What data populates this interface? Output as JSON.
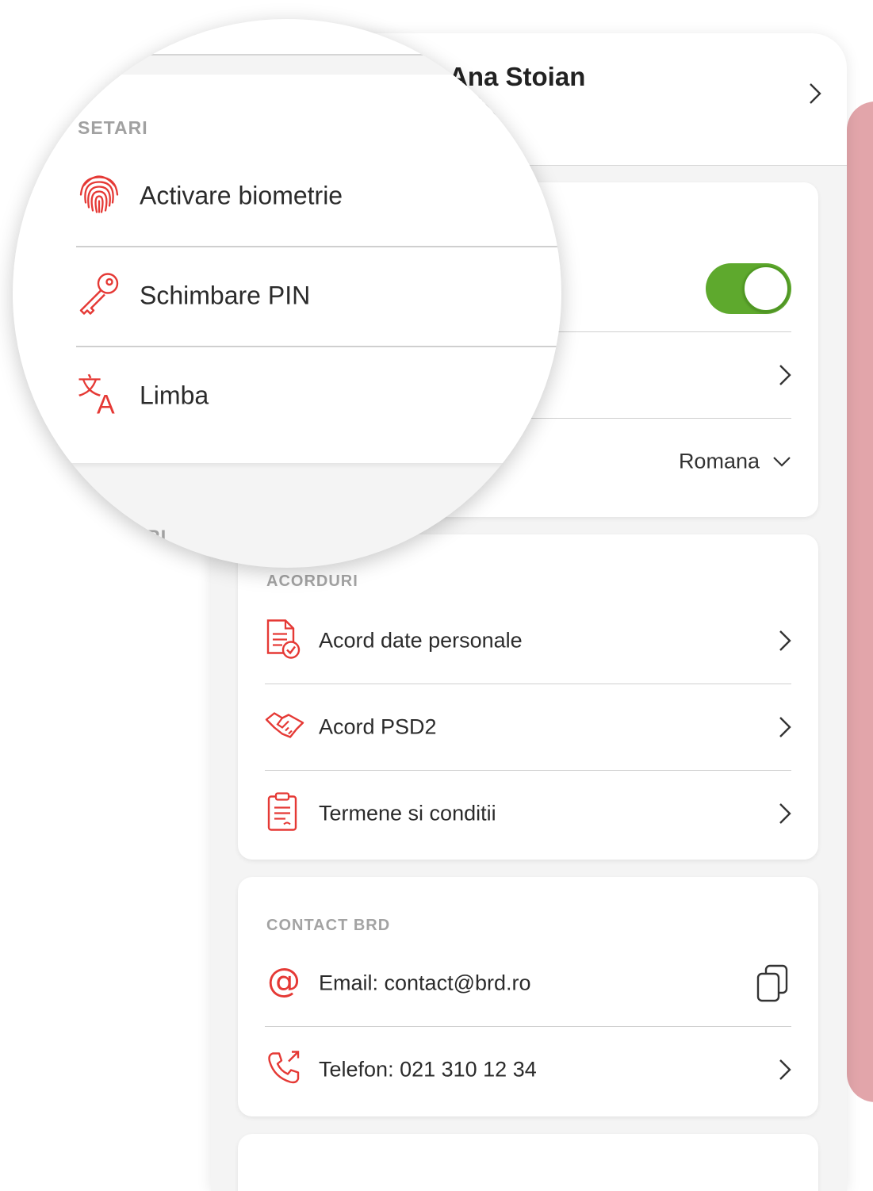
{
  "profile": {
    "name": "Ana Stoian",
    "name_visible": "a Stoian"
  },
  "settings": {
    "section_title": "SETARI",
    "biometrics_label": "Activare biometrie",
    "pin_label": "Schimbare PIN",
    "language_label": "Limba",
    "language_value": "Romana",
    "biometrics_enabled": true
  },
  "agreements": {
    "section_title": "ACORDURI",
    "section_title_clipped": "URI",
    "items": [
      {
        "label": "Acord date personale",
        "icon": "document-check-icon"
      },
      {
        "label": "Acord PSD2",
        "icon": "handshake-icon"
      },
      {
        "label": "Termene si conditii",
        "icon": "clipboard-icon"
      }
    ]
  },
  "contact": {
    "section_title": "CONTACT BRD",
    "email_label": "Email: contact@brd.ro",
    "phone_label": "Telefon: 021 310 12 34"
  },
  "colors": {
    "accent_red": "#e53935",
    "toggle_green": "#5ea92d",
    "side_pink": "#e2a5aa",
    "section_gray": "#a3a3a3"
  }
}
